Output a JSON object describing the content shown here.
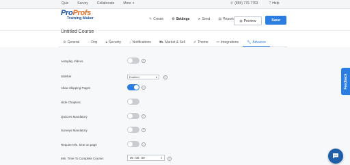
{
  "topnav": {
    "menu": [
      {
        "label": "Quiz"
      },
      {
        "label": "Survey"
      },
      {
        "label": "Collaborate"
      },
      {
        "label": "More"
      }
    ],
    "phone": "(855) 776-7763",
    "help": "Help"
  },
  "logo": {
    "brand_part1": "Pro",
    "brand_part2": "Profs",
    "sub": "Training Maker"
  },
  "actions": [
    {
      "label": "Create",
      "icon": "pencil-icon"
    },
    {
      "label": "Settings",
      "icon": "gear-icon"
    },
    {
      "label": "Send",
      "icon": "send-icon"
    },
    {
      "label": "Reports",
      "icon": "reports-icon"
    }
  ],
  "preview_label": "Preview",
  "save_label": "Save",
  "course_title": "Untitled Course",
  "tabs": [
    {
      "label": "General",
      "icon": "gear-icon"
    },
    {
      "label": "Drip",
      "icon": "drip-icon"
    },
    {
      "label": "Security",
      "icon": "lock-icon"
    },
    {
      "label": "Notifications",
      "icon": "bell-icon"
    },
    {
      "label": "Market & Sell",
      "icon": "cart-icon"
    },
    {
      "label": "Theme",
      "icon": "brush-icon"
    },
    {
      "label": "Integrations",
      "icon": "plug-icon"
    },
    {
      "label": "Advance",
      "icon": "wrench-icon"
    }
  ],
  "settings": {
    "autoplay_videos": {
      "label": "Autoplay Videos",
      "on": false
    },
    "sidebar": {
      "label": "Sidebar",
      "value": "Enabled"
    },
    "allow_skipping": {
      "label": "Allow Skipping Pages",
      "on": true
    },
    "hide_chapters": {
      "label": "Hide Chapters",
      "on": false
    },
    "quizzes_mandatory": {
      "label": "Quizzes Mandatory",
      "on": false
    },
    "surveys_mandatory": {
      "label": "Surveys Mandatory",
      "on": false
    },
    "require_min_time": {
      "label": "Require Min. time on page",
      "on": false
    },
    "min_time": {
      "label": "Min. Time To Complete Course:",
      "hh": "00",
      "mm": "00",
      "ss": "00"
    }
  },
  "feedback_label": "Feedback",
  "colors": {
    "accent": "#2b7de1",
    "brand_blue": "#1a4f9c",
    "brand_orange": "#e36b1e"
  }
}
